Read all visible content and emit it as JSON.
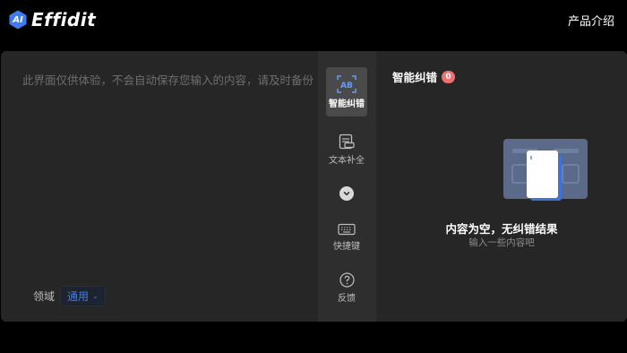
{
  "brand": {
    "logo_badge": "AI",
    "name": "Effidit"
  },
  "nav": {
    "product_intro": "产品介绍"
  },
  "editor": {
    "placeholder": "此界面仅供体验，不会自动保存您输入的内容，请及时备份",
    "domain_label": "领域",
    "domain_value": "通用"
  },
  "toolbar": {
    "items": [
      {
        "label": "智能纠错",
        "icon": "ab-correction-icon",
        "active": true,
        "icon_text": "AB"
      },
      {
        "label": "文本补全",
        "icon": "text-completion-icon",
        "active": false
      },
      {
        "label": "快捷键",
        "icon": "keyboard-icon",
        "active": false
      },
      {
        "label": "反馈",
        "icon": "question-icon",
        "active": false
      }
    ],
    "expand_icon": "chevron-down-icon"
  },
  "panel": {
    "title": "智能纠错",
    "count": "0",
    "empty_title": "内容为空，无纠错结果",
    "empty_subtitle": "输入一些内容吧"
  },
  "colors": {
    "background": "#000000",
    "panel": "#262626",
    "toolbar": "#2e2e2e",
    "accent": "#3f7cf2",
    "badge": "#f07070"
  }
}
